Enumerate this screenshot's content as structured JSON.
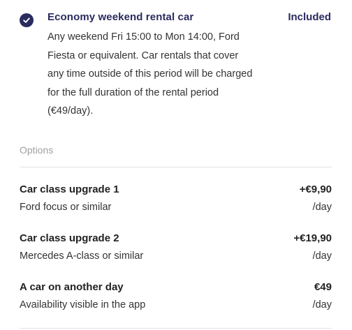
{
  "included": {
    "icon": "check-circle-icon",
    "title": "Economy weekend rental car",
    "status": "Included",
    "description": "Any weekend Fri 15:00 to Mon 14:00, Ford Fiesta or equivalent. Car rentals that cover any time outside of this period will be charged for the full duration of the rental period (€49/day)."
  },
  "options": {
    "label": "Options",
    "items": [
      {
        "title": "Car class upgrade 1",
        "subtitle": "Ford focus or similar",
        "price": "+€9,90",
        "unit": "/day"
      },
      {
        "title": "Car class upgrade 2",
        "subtitle": "Mercedes A-class or similar",
        "price": "+€19,90",
        "unit": "/day"
      },
      {
        "title": "A car on another day",
        "subtitle": "Availability visible in the app",
        "price": "€49",
        "unit": "/day"
      }
    ]
  },
  "colors": {
    "accent": "#2a2b5e",
    "divider": "#e2e2e2",
    "muted": "#a0a0a0"
  }
}
